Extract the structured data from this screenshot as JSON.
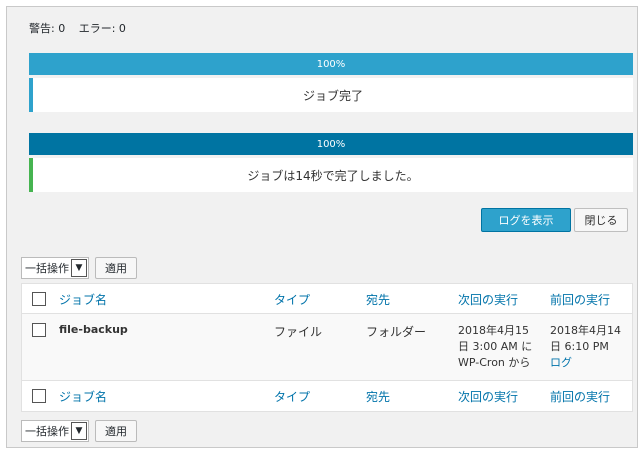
{
  "status": {
    "warnings": "警告: 0",
    "errors": "エラー: 0"
  },
  "progress1": {
    "label": "100%",
    "percent": 100,
    "message": "ジョブ完了"
  },
  "progress2": {
    "label": "100%",
    "percent": 100,
    "message": "ジョブは14秒で完了しました。"
  },
  "buttons": {
    "show_log": "ログを表示",
    "close": "閉じる"
  },
  "bulk": {
    "select_label": "一括操作",
    "apply_label": "適用"
  },
  "table": {
    "columns": [
      "ジョブ名",
      "タイプ",
      "宛先",
      "次回の実行",
      "前回の実行"
    ],
    "rows": [
      {
        "job_name": "file-backup",
        "type": "ファイル",
        "destination": "フォルダー",
        "next_run_line1": "2018年4月15",
        "next_run_line2": "日 3:00 AM に",
        "next_run_line3": "WP-Cron から",
        "last_run_line1": "2018年4月14",
        "last_run_line2": "日 6:10 PM",
        "last_run_log": "ログ"
      }
    ]
  },
  "colors": {
    "progress_light": "#2ea2cc",
    "progress_dark": "#0074a2",
    "success": "#46b450",
    "link": "#0073aa"
  }
}
